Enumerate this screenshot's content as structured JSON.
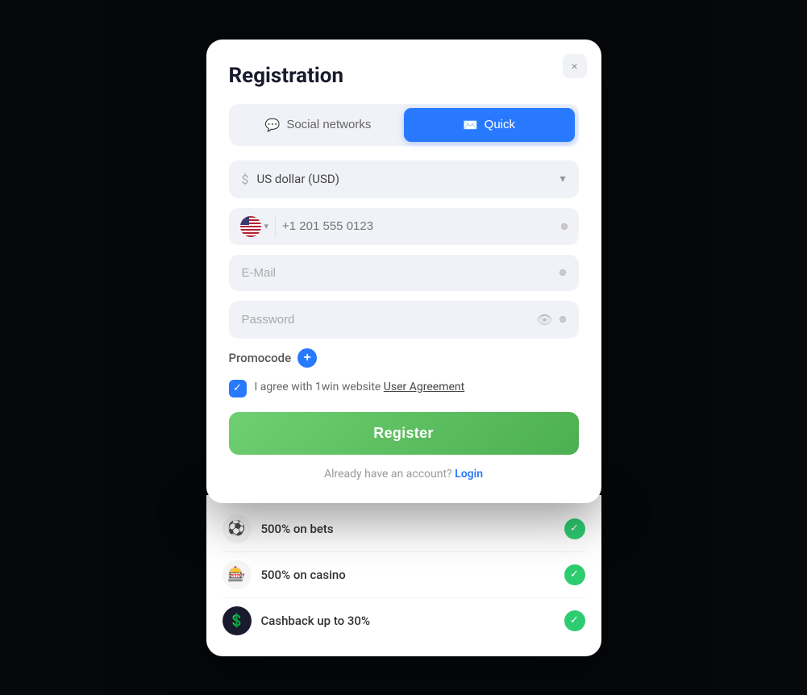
{
  "modal": {
    "title": "Registration",
    "close_label": "×",
    "tabs": [
      {
        "id": "social",
        "label": "Social networks",
        "active": false,
        "icon": "💬"
      },
      {
        "id": "quick",
        "label": "Quick",
        "active": true,
        "icon": "✉️"
      }
    ],
    "currency_field": {
      "placeholder": "US dollar (USD)",
      "icon": "$"
    },
    "phone_field": {
      "country_code": "+1",
      "placeholder": "+1 201 555 0123",
      "flag": "US"
    },
    "email_field": {
      "placeholder": "E-Mail"
    },
    "password_field": {
      "placeholder": "Password"
    },
    "promocode": {
      "label": "Promocode"
    },
    "agree_text": "I agree with 1win website ",
    "agree_link": "User Agreement",
    "register_btn": "Register",
    "already_account": "Already have an account?",
    "login_link": "Login"
  },
  "bonuses": [
    {
      "icon": "⚽",
      "text": "500% on bets",
      "bg": "#f0f0f0"
    },
    {
      "icon": "🎰",
      "text": "500% on casino",
      "bg": "#f0f0f0"
    },
    {
      "icon": "💲",
      "text": "Cashback up to 30%",
      "bg": "#1a1a2e"
    }
  ]
}
